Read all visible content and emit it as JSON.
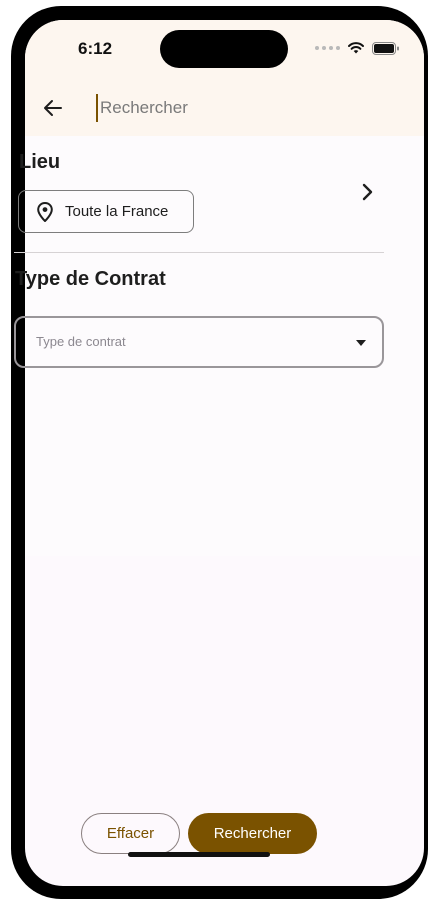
{
  "status": {
    "time": "6:12"
  },
  "header": {
    "search_placeholder": "Rechercher"
  },
  "location": {
    "title": "Lieu",
    "chip_label": "Toute la France"
  },
  "contract": {
    "title": "Type de Contrat",
    "select_placeholder": "Type de contrat"
  },
  "actions": {
    "clear_label": "Effacer",
    "search_label": "Rechercher"
  },
  "colors": {
    "accent": "#7a5200",
    "header_bg": "#fdf6ef",
    "screen_bg": "#fdf9fd"
  }
}
